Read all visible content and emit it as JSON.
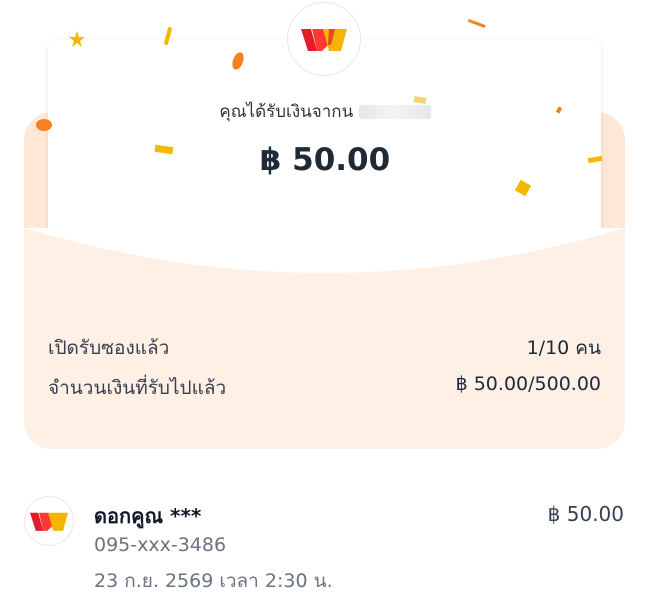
{
  "header": {
    "sender_text": "คุณได้รับเงินจากน",
    "amount": "฿ 50.00"
  },
  "summary": {
    "opened_label": "เปิดรับซองแล้ว",
    "opened_value": "1/10 คน",
    "received_label": "จำนวนเงินที่รับไปแล้ว",
    "received_value": "฿ 50.00/500.00"
  },
  "recipient": {
    "name": "ดอกคูณ ***",
    "phone": "095-xxx-3486",
    "datetime": "23 ก.ย. 2569 เวลา 2:30 น.",
    "amount": "฿ 50.00"
  },
  "colors": {
    "envelope_back": "#ffe7d6",
    "envelope_front": "#fff0e6",
    "logo_red": "#e11d2b",
    "logo_yellow": "#f5b400",
    "confetti_orange": "#f58220",
    "confetti_yellow": "#f5b800"
  },
  "icons": {
    "brand": "truemoney-wallet-logo-icon",
    "recipient": "truemoney-wallet-logo-icon"
  }
}
